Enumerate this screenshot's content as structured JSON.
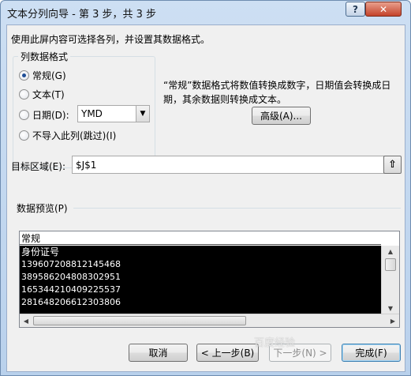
{
  "window": {
    "title": "文本分列向导 - 第 3 步，共 3 步",
    "help_label": "?",
    "close_label": "✕"
  },
  "instruction": "使用此屏内容可选择各列，并设置其数据格式。",
  "column_format": {
    "group_title": "列数据格式",
    "options": [
      {
        "label": "常规(G)",
        "selected": true
      },
      {
        "label": "文本(T)",
        "selected": false
      },
      {
        "label": "日期(D):",
        "selected": false
      },
      {
        "label": "不导入此列(跳过)(I)",
        "selected": false
      }
    ],
    "date_format_value": "YMD"
  },
  "description": "“常规”数据格式将数值转换成数字，日期值会转换成日期，其余数据则转换成文本。",
  "advanced_button": "高级(A)...",
  "target": {
    "label": "目标区域(E):",
    "value": "$J$1"
  },
  "preview": {
    "label": "数据预览(P)",
    "header": "常规",
    "rows": [
      "身份证号",
      "139607208812145468",
      "389586204808302951",
      "165344210409225537",
      "281648206612303806"
    ]
  },
  "buttons": {
    "cancel": "取消",
    "back": "< 上一步(B)",
    "next": "下一步(N) >",
    "finish": "完成(F)"
  },
  "watermark": "百度经验"
}
